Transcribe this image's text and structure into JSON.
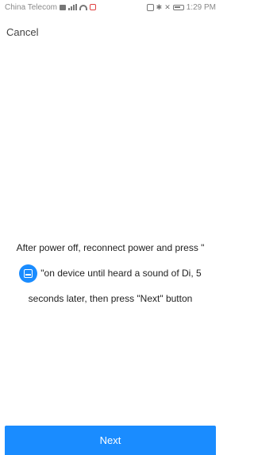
{
  "status_bar": {
    "carrier": "China Telecom",
    "time": "1:29 PM"
  },
  "header": {
    "cancel_label": "Cancel"
  },
  "instruction": {
    "line1": "After power off, reconnect power and press \"",
    "line2": "\"on device until heard a sound of Di, 5",
    "line3": "seconds later, then press \"Next\" button",
    "button_icon_color": "#1a8cff"
  },
  "footer": {
    "next_label": "Next",
    "accent_color": "#1a8cff"
  }
}
